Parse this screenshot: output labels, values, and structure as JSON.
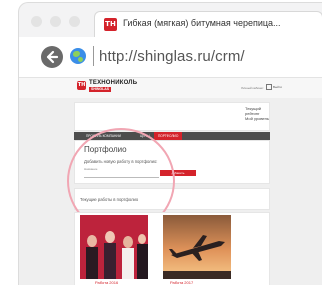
{
  "browser": {
    "tab_title": "Гибкая (мягкая) битумная черепица...",
    "favicon_text": "ТН",
    "url": "http://shinglas.ru/crm/"
  },
  "site": {
    "logo_name": "ТЕХНОНИКОЛЬ",
    "logo_sub": "SHINGLAS",
    "header_link": "Личный кабинет",
    "header_button": "Выйти",
    "cabinet_title": "Текущий рейтинг",
    "cabinet_sub": "Мой уровень",
    "nav": [
      "ПРОФИЛЬ КОМПАНИИ",
      "ЦЕНЫ",
      "ПОРТФОЛИО"
    ],
    "portfolio_title": "Портфолио",
    "add_work_label": "Добавить новую работу в портфолио:",
    "input_label": "Название",
    "add_button": "добавить",
    "current_works_label": "Текущие работы в портфолио",
    "works": [
      {
        "caption": "Работа 2016"
      },
      {
        "caption": "Работа 2017"
      }
    ]
  },
  "colors": {
    "brand": "#d4232b",
    "highlight": "#f1a6b3",
    "nav_bg": "#4d4d4d"
  }
}
